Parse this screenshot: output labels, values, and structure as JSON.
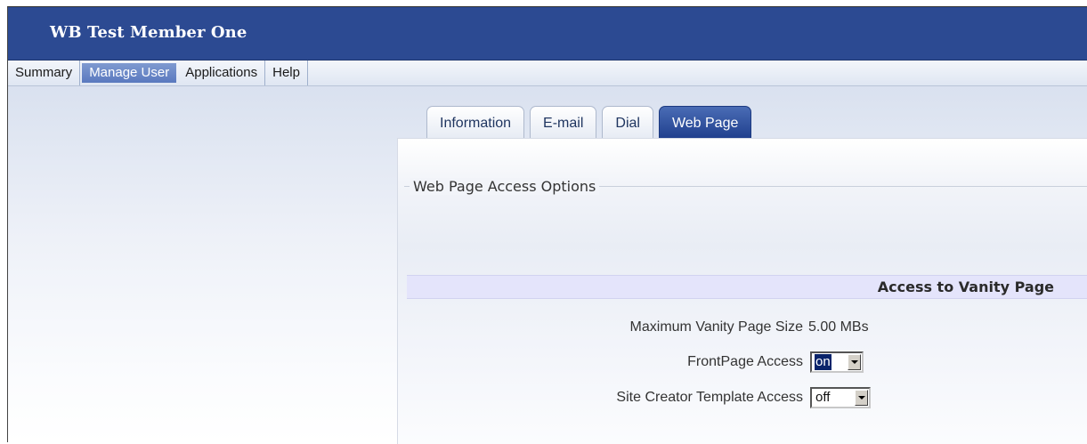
{
  "header": {
    "title": "WB Test Member One"
  },
  "menu": {
    "items": [
      {
        "label": "Summary"
      },
      {
        "label": "Manage User"
      },
      {
        "label": "Applications"
      },
      {
        "label": "Help"
      }
    ],
    "active": "Manage User"
  },
  "tabs": {
    "items": [
      {
        "label": "Information"
      },
      {
        "label": "E-mail"
      },
      {
        "label": "Dial"
      },
      {
        "label": "Web Page"
      }
    ],
    "active": "Web Page"
  },
  "panel": {
    "legend": "Web Page Access Options",
    "section_title": "Access to Vanity Page",
    "max_size_label": "Maximum Vanity Page Size",
    "max_size_value": "5.00 MBs",
    "frontpage_label": "FrontPage Access",
    "frontpage_value": "on",
    "site_creator_label": "Site Creator Template Access",
    "site_creator_value": "off"
  },
  "colors": {
    "title_bar": "#2c4a92",
    "active_tab": "#1f3f8d",
    "section_bar": "#e4e4fb"
  }
}
